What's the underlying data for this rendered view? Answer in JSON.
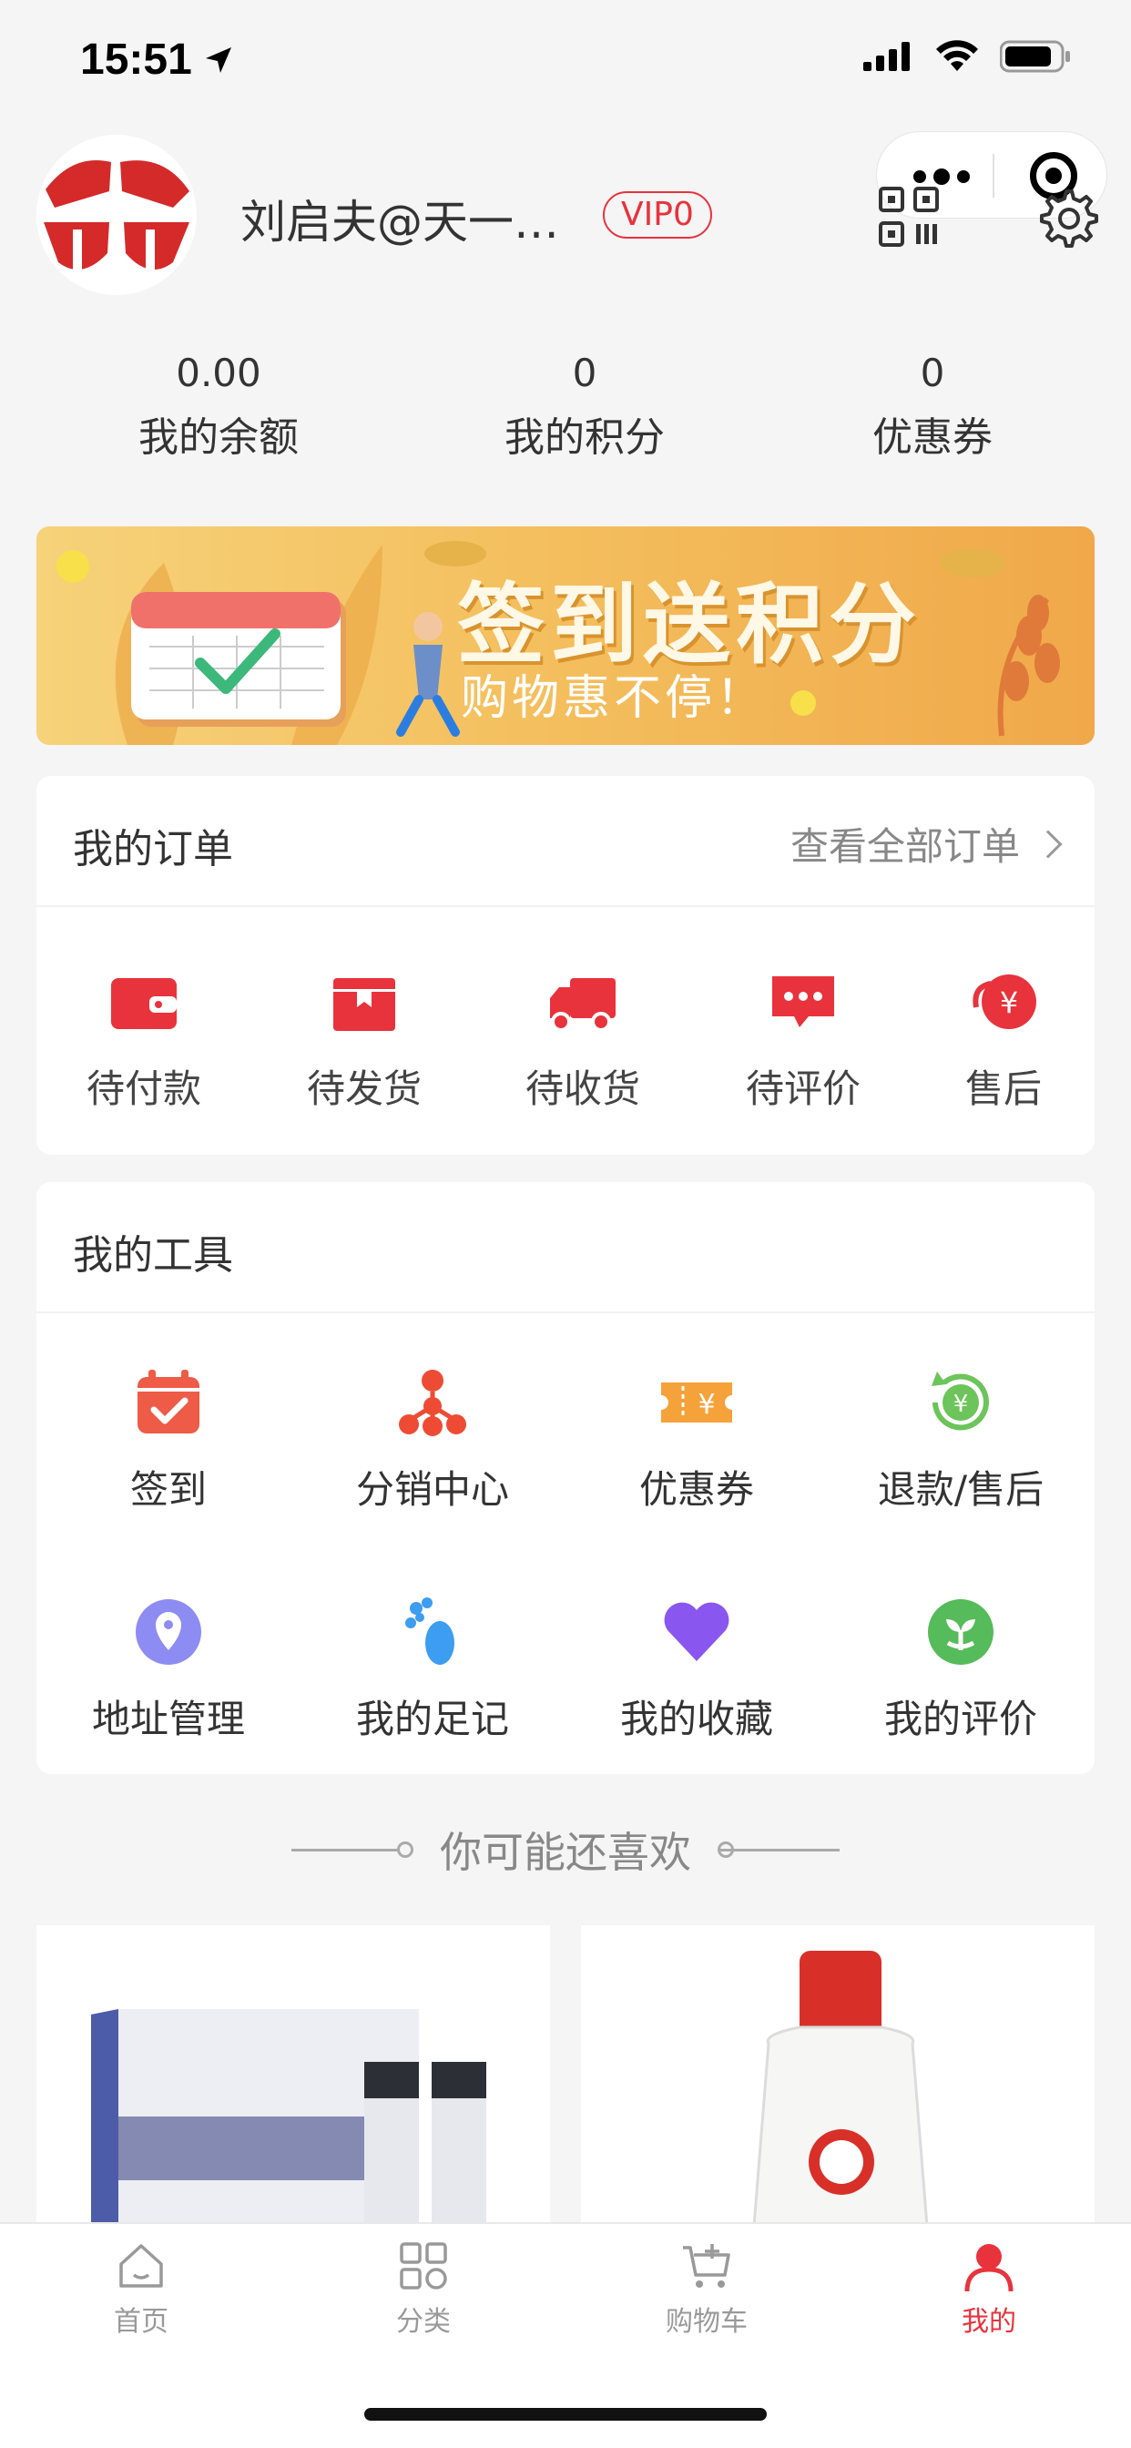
{
  "status_bar": {
    "time": "15:51"
  },
  "profile": {
    "username": "刘启夫@天一…",
    "vip": "VIP0"
  },
  "stats": [
    {
      "value": "0.00",
      "label": "我的余额"
    },
    {
      "value": "0",
      "label": "我的积分"
    },
    {
      "value": "0",
      "label": "优惠券"
    }
  ],
  "banner": {
    "title": "签到送积分",
    "subtitle": "购物惠不停！"
  },
  "orders": {
    "title": "我的订单",
    "view_all": "查看全部订单",
    "items": [
      {
        "label": "待付款",
        "icon": "wallet-icon"
      },
      {
        "label": "待发货",
        "icon": "package-icon"
      },
      {
        "label": "待收货",
        "icon": "truck-icon"
      },
      {
        "label": "待评价",
        "icon": "chat-icon"
      },
      {
        "label": "售后",
        "icon": "refund-icon"
      }
    ]
  },
  "tools": {
    "title": "我的工具",
    "items": [
      {
        "label": "签到",
        "icon": "calendar-check-icon"
      },
      {
        "label": "分销中心",
        "icon": "network-icon"
      },
      {
        "label": "优惠券",
        "icon": "coupon-icon"
      },
      {
        "label": "退款/售后",
        "icon": "refund-cycle-icon"
      },
      {
        "label": "地址管理",
        "icon": "location-pin-icon"
      },
      {
        "label": "我的足记",
        "icon": "footprint-icon"
      },
      {
        "label": "我的收藏",
        "icon": "heart-icon"
      },
      {
        "label": "我的评价",
        "icon": "sprout-icon"
      }
    ]
  },
  "recommend": {
    "title": "你可能还喜欢"
  },
  "tabbar": [
    {
      "label": "首页",
      "icon": "home-icon",
      "active": false
    },
    {
      "label": "分类",
      "icon": "category-icon",
      "active": false
    },
    {
      "label": "购物车",
      "icon": "cart-icon",
      "active": false
    },
    {
      "label": "我的",
      "icon": "user-icon",
      "active": true
    }
  ],
  "colors": {
    "accent": "#e8333c",
    "background": "#f5f5f5",
    "banner": "#f4c05f"
  }
}
